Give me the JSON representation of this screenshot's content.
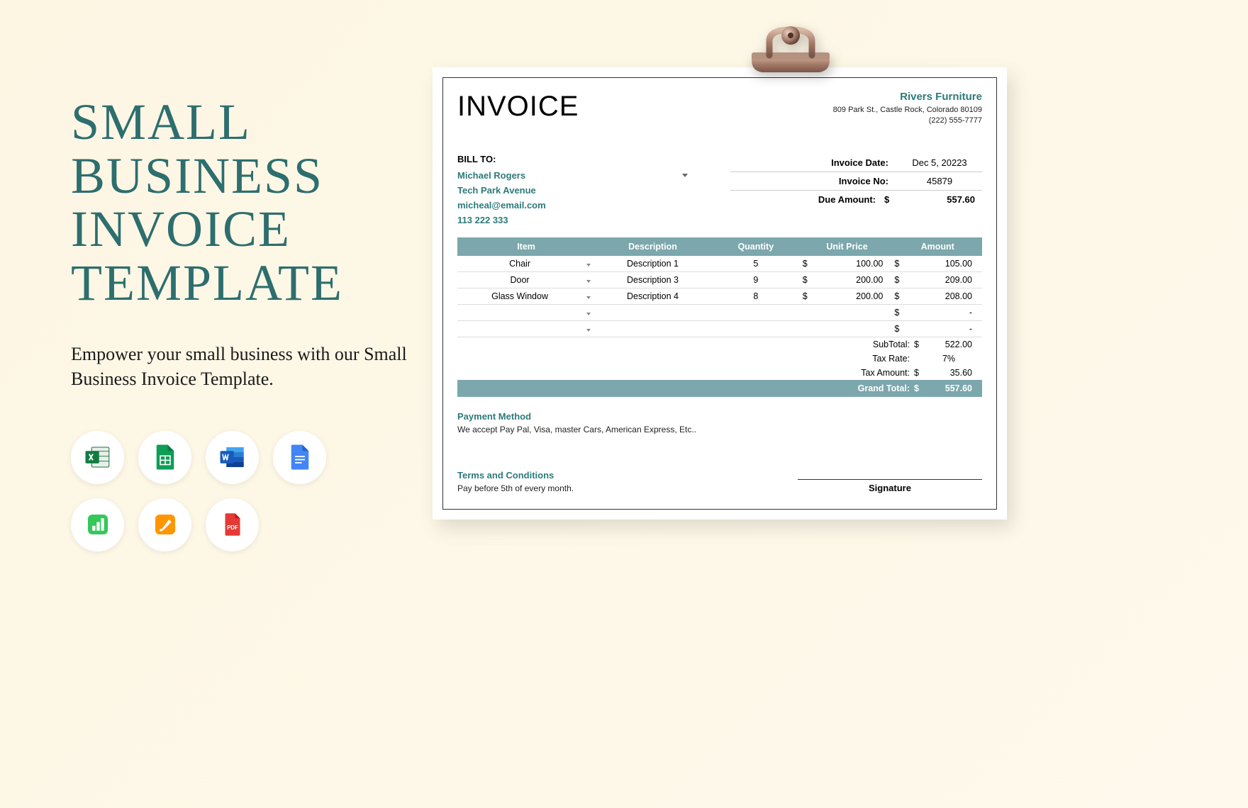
{
  "hero": {
    "title": "SMALL\nBUSINESS\nINVOICE\nTEMPLATE",
    "subtitle": "Empower your small business with our Small Business Invoice Template."
  },
  "formats": [
    "excel",
    "google-sheets",
    "word",
    "google-docs",
    "numbers",
    "pages",
    "pdf"
  ],
  "invoice": {
    "doc_title": "INVOICE",
    "company": {
      "name": "Rivers Furniture",
      "address": "809 Park St., Castle Rock, Colorado 80109",
      "phone": "(222) 555-7777"
    },
    "bill_to_label": "BILL TO:",
    "bill_to": {
      "name": "Michael Rogers",
      "address": "Tech Park Avenue",
      "email": "micheal@email.com",
      "phone": "113 222 333"
    },
    "meta": {
      "date_label": "Invoice Date:",
      "date_value": "Dec 5, 20223",
      "no_label": "Invoice No:",
      "no_value": "45879",
      "due_label": "Due Amount:",
      "due_currency": "$",
      "due_value": "557.60"
    },
    "columns": {
      "item": "Item",
      "description": "Description",
      "quantity": "Quantity",
      "unit_price": "Unit Price",
      "amount": "Amount"
    },
    "rows": [
      {
        "item": "Chair",
        "desc": "Description 1",
        "qty": "5",
        "price": "100.00",
        "amount": "105.00"
      },
      {
        "item": "Door",
        "desc": "Description 3",
        "qty": "9",
        "price": "200.00",
        "amount": "209.00"
      },
      {
        "item": "Glass Window",
        "desc": "Description 4",
        "qty": "8",
        "price": "200.00",
        "amount": "208.00"
      },
      {
        "item": "",
        "desc": "",
        "qty": "",
        "price": "",
        "amount": "-"
      },
      {
        "item": "",
        "desc": "",
        "qty": "",
        "price": "",
        "amount": "-"
      }
    ],
    "totals": {
      "subtotal_label": "SubTotal:",
      "subtotal": "522.00",
      "taxrate_label": "Tax Rate:",
      "taxrate": "7%",
      "taxamt_label": "Tax Amount:",
      "taxamt": "35.60",
      "grand_label": "Grand Total:",
      "grand": "557.60",
      "currency": "$"
    },
    "payment": {
      "heading": "Payment Method",
      "text": "We accept Pay Pal, Visa, master Cars, American Express, Etc.."
    },
    "terms": {
      "heading": "Terms and Conditions",
      "text": "Pay before 5th of every month."
    },
    "signature_label": "Signature"
  }
}
